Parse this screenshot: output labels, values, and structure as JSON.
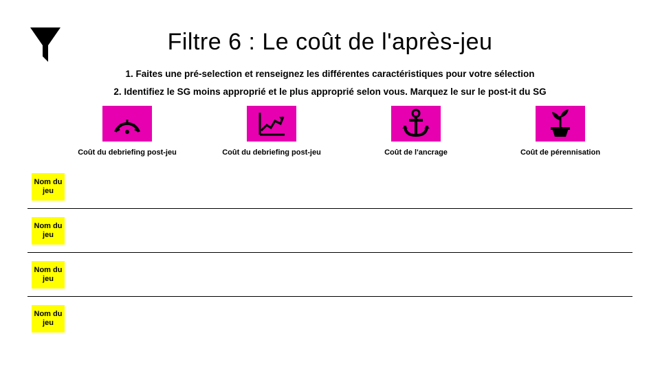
{
  "title": "Filtre 6 : Le coût de l'après-jeu",
  "instruction1": "1. Faites une pré-selection et renseignez les différentes caractéristiques pour votre sélection",
  "instruction2": "2. Identifiez le SG moins approprié et le plus approprié selon vous. Marquez le sur le post-it du SG",
  "columns": [
    {
      "label": "Coût du debriefing post-jeu"
    },
    {
      "label": "Coût du debriefing post-jeu"
    },
    {
      "label": "Coût de l'ancrage"
    },
    {
      "label": "Coût de pérennisation"
    }
  ],
  "rows": [
    {
      "sticky": "Nom du jeu"
    },
    {
      "sticky": "Nom du jeu"
    },
    {
      "sticky": "Nom du jeu"
    },
    {
      "sticky": "Nom du jeu"
    }
  ],
  "colors": {
    "magenta": "#e600b0",
    "yellow": "#ffff00"
  }
}
